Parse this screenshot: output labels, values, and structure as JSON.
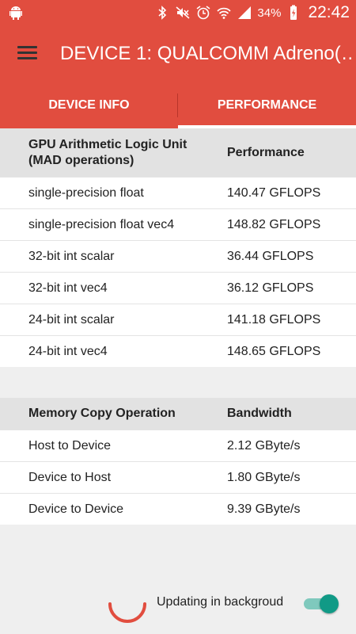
{
  "status_bar": {
    "battery_percent": "34%",
    "time": "22:42",
    "icons": [
      "android-icon",
      "bluetooth-icon",
      "mute-icon",
      "alarm-icon",
      "wifi-icon",
      "signal-icon",
      "battery-charging-icon"
    ]
  },
  "app_bar": {
    "title": "DEVICE 1: QUALCOMM Adreno(…",
    "menu_icon": "hamburger-menu-icon"
  },
  "tabs": [
    {
      "label": "DEVICE INFO",
      "active": false
    },
    {
      "label": "PERFORMANCE",
      "active": true
    }
  ],
  "gpu_table": {
    "header": {
      "name": "GPU Arithmetic Logic Unit (MAD operations)",
      "value": "Performance"
    },
    "rows": [
      {
        "name": "single-precision float",
        "value": "140.47 GFLOPS"
      },
      {
        "name": "single-precision float vec4",
        "value": "148.82 GFLOPS"
      },
      {
        "name": "32-bit int scalar",
        "value": "36.44 GFLOPS"
      },
      {
        "name": "32-bit int vec4",
        "value": "36.12 GFLOPS"
      },
      {
        "name": "24-bit int scalar",
        "value": "141.18 GFLOPS"
      },
      {
        "name": "24-bit int vec4",
        "value": "148.65 GFLOPS"
      }
    ]
  },
  "memory_table": {
    "header": {
      "name": "Memory Copy Operation",
      "value": "Bandwidth"
    },
    "rows": [
      {
        "name": "Host to Device",
        "value": "2.12 GByte/s"
      },
      {
        "name": "Device to Host",
        "value": "1.80 GByte/s"
      },
      {
        "name": "Device to Device",
        "value": "9.39 GByte/s"
      }
    ]
  },
  "footer": {
    "update_label": "Updating in backgroud",
    "update_toggle_on": true
  },
  "colors": {
    "primary": "#e14d3f",
    "toggle_accent": "#119a86",
    "spinner": "#e14d3f"
  }
}
